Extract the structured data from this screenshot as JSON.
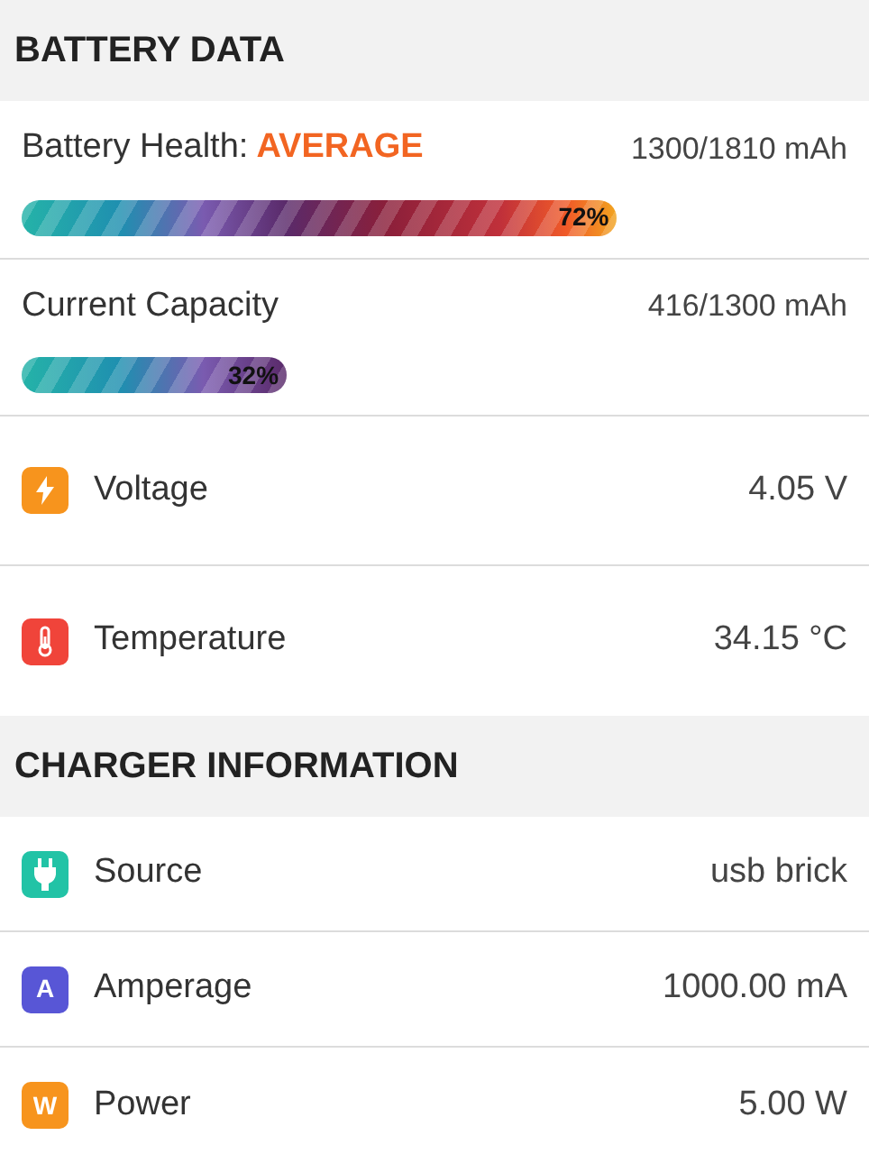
{
  "sections": [
    {
      "title": "BATTERY DATA",
      "rows": [
        {
          "kind": "meter",
          "label": "Battery Health:",
          "status": "AVERAGE",
          "value": "1300/1810 mAh",
          "level": 0.72,
          "reading": "72%"
        },
        {
          "kind": "meter",
          "label": "Current Capacity",
          "value": "416/1300 mAh",
          "level": 0.32,
          "reading": "32%"
        },
        {
          "kind": "bolt",
          "color": "#f7941d",
          "label": "Voltage",
          "value": "4.05 V"
        },
        {
          "kind": "thermometer",
          "color": "#f0443a",
          "label": "Temperature",
          "value": "34.15 °C"
        }
      ]
    },
    {
      "title": "CHARGER INFORMATION",
      "rows": [
        {
          "kind": "plug",
          "color": "#22c3a6",
          "label": "Source",
          "value": "usb brick"
        },
        {
          "kind": "letter",
          "glyph": "A",
          "color": "#5856d6",
          "label": "Amperage",
          "value": "1000.00 mA"
        },
        {
          "kind": "letter",
          "glyph": "W",
          "color": "#f7941d",
          "label": "Power",
          "value": "5.00 W"
        }
      ]
    }
  ]
}
